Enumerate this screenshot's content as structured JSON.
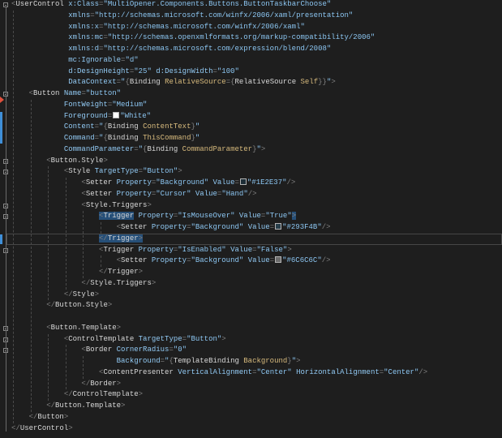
{
  "editor": {
    "language": "XAML",
    "colors": {
      "background": "#1E1E1E",
      "bracket": "#808080",
      "element": "#D7D7D7",
      "attribute": "#92CAF4",
      "value": "#8CC6F2",
      "markup": "#D7BA7D",
      "selection": "#264F78"
    },
    "current_line": 22,
    "lines": [
      {
        "tokens": [
          [
            "b",
            "<"
          ],
          [
            "e",
            "UserControl"
          ],
          [
            "p",
            " "
          ],
          [
            "a",
            "x:Class"
          ],
          [
            "b",
            "="
          ],
          [
            "v",
            "\"MultiOpener.Components.Buttons.ButtonTaskbarChoose\""
          ]
        ]
      },
      {
        "tokens": [
          [
            "p",
            "             "
          ],
          [
            "a",
            "xmlns"
          ],
          [
            "b",
            "="
          ],
          [
            "v",
            "\"http://schemas.microsoft.com/winfx/2006/xaml/presentation\""
          ]
        ]
      },
      {
        "tokens": [
          [
            "p",
            "             "
          ],
          [
            "a",
            "xmlns:x"
          ],
          [
            "b",
            "="
          ],
          [
            "v",
            "\"http://schemas.microsoft.com/winfx/2006/xaml\""
          ]
        ]
      },
      {
        "tokens": [
          [
            "p",
            "             "
          ],
          [
            "a",
            "xmlns:mc"
          ],
          [
            "b",
            "="
          ],
          [
            "v",
            "\"http://schemas.openxmlformats.org/markup-compatibility/2006\""
          ]
        ]
      },
      {
        "tokens": [
          [
            "p",
            "             "
          ],
          [
            "a",
            "xmlns:d"
          ],
          [
            "b",
            "="
          ],
          [
            "v",
            "\"http://schemas.microsoft.com/expression/blend/2008\""
          ]
        ]
      },
      {
        "tokens": [
          [
            "p",
            "             "
          ],
          [
            "a",
            "mc:Ignorable"
          ],
          [
            "b",
            "="
          ],
          [
            "v",
            "\"d\""
          ]
        ]
      },
      {
        "tokens": [
          [
            "p",
            "             "
          ],
          [
            "a",
            "d:DesignHeight"
          ],
          [
            "b",
            "="
          ],
          [
            "v",
            "\"25\""
          ],
          [
            "p",
            " "
          ],
          [
            "a",
            "d:DesignWidth"
          ],
          [
            "b",
            "="
          ],
          [
            "v",
            "\"100\""
          ]
        ]
      },
      {
        "tokens": [
          [
            "p",
            "             "
          ],
          [
            "a",
            "DataContext"
          ],
          [
            "b",
            "="
          ],
          [
            "v",
            "\""
          ],
          [
            "b",
            "{"
          ],
          [
            "e",
            "Binding "
          ],
          [
            "m",
            "RelativeSource"
          ],
          [
            "b",
            "={"
          ],
          [
            "e",
            "RelativeSource "
          ],
          [
            "m",
            "Self"
          ],
          [
            "b",
            "}}"
          ],
          [
            "v",
            "\""
          ],
          [
            "b",
            ">"
          ]
        ]
      },
      {
        "tokens": [
          [
            "p",
            "    "
          ],
          [
            "b",
            "<"
          ],
          [
            "e",
            "Button"
          ],
          [
            "p",
            " "
          ],
          [
            "a",
            "Name"
          ],
          [
            "b",
            "="
          ],
          [
            "v",
            "\"button\""
          ]
        ]
      },
      {
        "tokens": [
          [
            "p",
            "            "
          ],
          [
            "a",
            "FontWeight"
          ],
          [
            "b",
            "="
          ],
          [
            "v",
            "\"Medium\""
          ]
        ]
      },
      {
        "tokens": [
          [
            "p",
            "            "
          ],
          [
            "a",
            "Foreground"
          ],
          [
            "b",
            "="
          ],
          [
            "s",
            "#FFFFFF"
          ],
          [
            "v",
            "\"White\""
          ]
        ]
      },
      {
        "tokens": [
          [
            "p",
            "            "
          ],
          [
            "a",
            "Content"
          ],
          [
            "b",
            "="
          ],
          [
            "v",
            "\""
          ],
          [
            "b",
            "{"
          ],
          [
            "e",
            "Binding "
          ],
          [
            "m",
            "ContentText"
          ],
          [
            "b",
            "}"
          ],
          [
            "v",
            "\""
          ]
        ]
      },
      {
        "tokens": [
          [
            "p",
            "            "
          ],
          [
            "a",
            "Command"
          ],
          [
            "b",
            "="
          ],
          [
            "v",
            "\""
          ],
          [
            "b",
            "{"
          ],
          [
            "e",
            "Binding "
          ],
          [
            "m",
            "ThisCommand"
          ],
          [
            "b",
            "}"
          ],
          [
            "v",
            "\""
          ]
        ]
      },
      {
        "tokens": [
          [
            "p",
            "            "
          ],
          [
            "a",
            "CommandParameter"
          ],
          [
            "b",
            "="
          ],
          [
            "v",
            "\""
          ],
          [
            "b",
            "{"
          ],
          [
            "e",
            "Binding "
          ],
          [
            "m",
            "CommandParameter"
          ],
          [
            "b",
            "}"
          ],
          [
            "v",
            "\""
          ],
          [
            "b",
            ">"
          ]
        ]
      },
      {
        "tokens": [
          [
            "p",
            "        "
          ],
          [
            "b",
            "<"
          ],
          [
            "e",
            "Button.Style"
          ],
          [
            "b",
            ">"
          ]
        ]
      },
      {
        "tokens": [
          [
            "p",
            "            "
          ],
          [
            "b",
            "<"
          ],
          [
            "e",
            "Style"
          ],
          [
            "p",
            " "
          ],
          [
            "a",
            "TargetType"
          ],
          [
            "b",
            "="
          ],
          [
            "v",
            "\"Button\""
          ],
          [
            "b",
            ">"
          ]
        ]
      },
      {
        "tokens": [
          [
            "p",
            "                "
          ],
          [
            "b",
            "<"
          ],
          [
            "e",
            "Setter"
          ],
          [
            "p",
            " "
          ],
          [
            "a",
            "Property"
          ],
          [
            "b",
            "="
          ],
          [
            "v",
            "\"Background\""
          ],
          [
            "p",
            " "
          ],
          [
            "a",
            "Value"
          ],
          [
            "b",
            "="
          ],
          [
            "s",
            "#1E2E37"
          ],
          [
            "v",
            "\"#1E2E37\""
          ],
          [
            "b",
            "/>"
          ]
        ]
      },
      {
        "tokens": [
          [
            "p",
            "                "
          ],
          [
            "b",
            "<"
          ],
          [
            "e",
            "Setter"
          ],
          [
            "p",
            " "
          ],
          [
            "a",
            "Property"
          ],
          [
            "b",
            "="
          ],
          [
            "v",
            "\"Cursor\""
          ],
          [
            "p",
            " "
          ],
          [
            "a",
            "Value"
          ],
          [
            "b",
            "="
          ],
          [
            "v",
            "\"Hand\""
          ],
          [
            "b",
            "/>"
          ]
        ]
      },
      {
        "tokens": [
          [
            "p",
            "                "
          ],
          [
            "b",
            "<"
          ],
          [
            "e",
            "Style.Triggers"
          ],
          [
            "b",
            ">"
          ]
        ]
      },
      {
        "tokens": [
          [
            "p",
            "                    "
          ],
          [
            "b",
            "<",
            "sel"
          ],
          [
            "e",
            "Trigger",
            "sel"
          ],
          [
            "p",
            " "
          ],
          [
            "a",
            "Property"
          ],
          [
            "b",
            "="
          ],
          [
            "v",
            "\"IsMouseOver\""
          ],
          [
            "p",
            " "
          ],
          [
            "a",
            "Value"
          ],
          [
            "b",
            "="
          ],
          [
            "v",
            "\"True\""
          ],
          [
            "b",
            ">",
            "sel"
          ]
        ]
      },
      {
        "tokens": [
          [
            "p",
            "                        "
          ],
          [
            "b",
            "<"
          ],
          [
            "e",
            "Setter"
          ],
          [
            "p",
            " "
          ],
          [
            "a",
            "Property"
          ],
          [
            "b",
            "="
          ],
          [
            "v",
            "\"Background\""
          ],
          [
            "p",
            " "
          ],
          [
            "a",
            "Value"
          ],
          [
            "b",
            "="
          ],
          [
            "s",
            "#293F4B"
          ],
          [
            "v",
            "\"#293F4B\""
          ],
          [
            "b",
            "/>"
          ]
        ]
      },
      {
        "tokens": [
          [
            "p",
            "                    "
          ],
          [
            "b",
            "</",
            "sel"
          ],
          [
            "e",
            "Trigger",
            "sel"
          ],
          [
            "b",
            ">",
            "sel"
          ]
        ]
      },
      {
        "tokens": [
          [
            "p",
            "                    "
          ],
          [
            "b",
            "<"
          ],
          [
            "e",
            "Trigger"
          ],
          [
            "p",
            " "
          ],
          [
            "a",
            "Property"
          ],
          [
            "b",
            "="
          ],
          [
            "v",
            "\"IsEnabled\""
          ],
          [
            "p",
            " "
          ],
          [
            "a",
            "Value"
          ],
          [
            "b",
            "="
          ],
          [
            "v",
            "\"False\""
          ],
          [
            "b",
            ">"
          ]
        ]
      },
      {
        "tokens": [
          [
            "p",
            "                        "
          ],
          [
            "b",
            "<"
          ],
          [
            "e",
            "Setter"
          ],
          [
            "p",
            " "
          ],
          [
            "a",
            "Property"
          ],
          [
            "b",
            "="
          ],
          [
            "v",
            "\"Background\""
          ],
          [
            "p",
            " "
          ],
          [
            "a",
            "Value"
          ],
          [
            "b",
            "="
          ],
          [
            "s",
            "#6C6C6C"
          ],
          [
            "v",
            "\"#6C6C6C\""
          ],
          [
            "b",
            "/>"
          ]
        ]
      },
      {
        "tokens": [
          [
            "p",
            "                    "
          ],
          [
            "b",
            "</"
          ],
          [
            "e",
            "Trigger"
          ],
          [
            "b",
            ">"
          ]
        ]
      },
      {
        "tokens": [
          [
            "p",
            "                "
          ],
          [
            "b",
            "</"
          ],
          [
            "e",
            "Style.Triggers"
          ],
          [
            "b",
            ">"
          ]
        ]
      },
      {
        "tokens": [
          [
            "p",
            "            "
          ],
          [
            "b",
            "</"
          ],
          [
            "e",
            "Style"
          ],
          [
            "b",
            ">"
          ]
        ]
      },
      {
        "tokens": [
          [
            "p",
            "        "
          ],
          [
            "b",
            "</"
          ],
          [
            "e",
            "Button.Style"
          ],
          [
            "b",
            ">"
          ]
        ]
      },
      {
        "tokens": []
      },
      {
        "tokens": [
          [
            "p",
            "        "
          ],
          [
            "b",
            "<"
          ],
          [
            "e",
            "Button.Template"
          ],
          [
            "b",
            ">"
          ]
        ]
      },
      {
        "tokens": [
          [
            "p",
            "            "
          ],
          [
            "b",
            "<"
          ],
          [
            "e",
            "ControlTemplate"
          ],
          [
            "p",
            " "
          ],
          [
            "a",
            "TargetType"
          ],
          [
            "b",
            "="
          ],
          [
            "v",
            "\"Button\""
          ],
          [
            "b",
            ">"
          ]
        ]
      },
      {
        "tokens": [
          [
            "p",
            "                "
          ],
          [
            "b",
            "<"
          ],
          [
            "e",
            "Border"
          ],
          [
            "p",
            " "
          ],
          [
            "a",
            "CornerRadius"
          ],
          [
            "b",
            "="
          ],
          [
            "v",
            "\"0\""
          ]
        ]
      },
      {
        "tokens": [
          [
            "p",
            "                        "
          ],
          [
            "a",
            "Background"
          ],
          [
            "b",
            "="
          ],
          [
            "v",
            "\""
          ],
          [
            "b",
            "{"
          ],
          [
            "e",
            "TemplateBinding "
          ],
          [
            "m",
            "Background"
          ],
          [
            "b",
            "}"
          ],
          [
            "v",
            "\""
          ],
          [
            "b",
            ">"
          ]
        ]
      },
      {
        "tokens": [
          [
            "p",
            "                    "
          ],
          [
            "b",
            "<"
          ],
          [
            "e",
            "ContentPresenter"
          ],
          [
            "p",
            " "
          ],
          [
            "a",
            "VerticalAlignment"
          ],
          [
            "b",
            "="
          ],
          [
            "v",
            "\"Center\""
          ],
          [
            "p",
            " "
          ],
          [
            "a",
            "HorizontalAlignment"
          ],
          [
            "b",
            "="
          ],
          [
            "v",
            "\"Center\""
          ],
          [
            "b",
            "/>"
          ]
        ]
      },
      {
        "tokens": [
          [
            "p",
            "                "
          ],
          [
            "b",
            "</"
          ],
          [
            "e",
            "Border"
          ],
          [
            "b",
            ">"
          ]
        ]
      },
      {
        "tokens": [
          [
            "p",
            "            "
          ],
          [
            "b",
            "</"
          ],
          [
            "e",
            "ControlTemplate"
          ],
          [
            "b",
            ">"
          ]
        ]
      },
      {
        "tokens": [
          [
            "p",
            "        "
          ],
          [
            "b",
            "</"
          ],
          [
            "e",
            "Button.Template"
          ],
          [
            "b",
            ">"
          ]
        ]
      },
      {
        "tokens": [
          [
            "p",
            "    "
          ],
          [
            "b",
            "</"
          ],
          [
            "e",
            "Button"
          ],
          [
            "b",
            ">"
          ]
        ]
      },
      {
        "tokens": [
          [
            "b",
            "</"
          ],
          [
            "e",
            "UserControl"
          ],
          [
            "b",
            ">"
          ]
        ]
      }
    ]
  }
}
